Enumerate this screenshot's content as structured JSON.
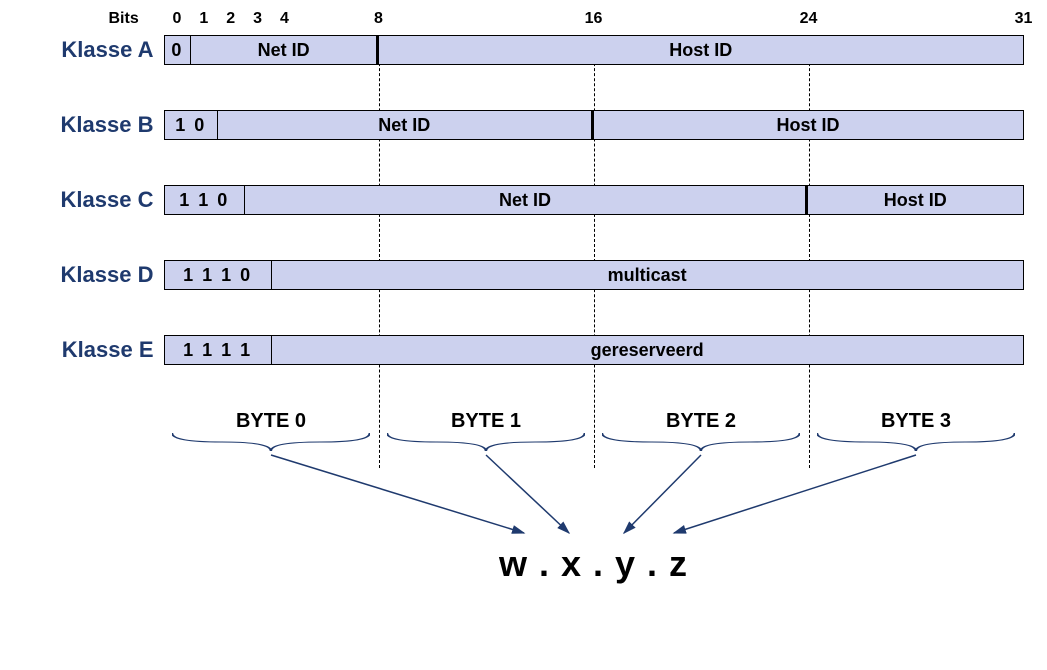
{
  "bits_label": "Bits",
  "bit_positions": [
    0,
    1,
    2,
    3,
    4,
    8,
    16,
    24,
    31
  ],
  "classes": [
    {
      "name": "Klasse A",
      "segments": [
        {
          "label": "0",
          "width_bits": 1,
          "thick": false,
          "cls": "prefix-bits"
        },
        {
          "label": "Net ID",
          "width_bits": 7,
          "thick": true
        },
        {
          "label": "Host ID",
          "width_bits": 24,
          "thick": false
        }
      ]
    },
    {
      "name": "Klasse B",
      "segments": [
        {
          "label": "1 0",
          "width_bits": 2,
          "thick": false,
          "cls": "prefix-bits"
        },
        {
          "label": "Net ID",
          "width_bits": 14,
          "thick": true
        },
        {
          "label": "Host ID",
          "width_bits": 16,
          "thick": false
        }
      ]
    },
    {
      "name": "Klasse C",
      "segments": [
        {
          "label": "1 1 0",
          "width_bits": 3,
          "thick": false,
          "cls": "prefix-bits"
        },
        {
          "label": "Net ID",
          "width_bits": 21,
          "thick": true
        },
        {
          "label": "Host ID",
          "width_bits": 8,
          "thick": false
        }
      ]
    },
    {
      "name": "Klasse D",
      "segments": [
        {
          "label": "1 1 1 0",
          "width_bits": 4,
          "thick": false,
          "cls": "prefix-bits"
        },
        {
          "label": "multicast",
          "width_bits": 28,
          "thick": false
        }
      ]
    },
    {
      "name": "Klasse E",
      "segments": [
        {
          "label": "1 1 1 1",
          "width_bits": 4,
          "thick": false,
          "cls": "prefix-bits"
        },
        {
          "label": "gereserveerd",
          "width_bits": 28,
          "thick": false
        }
      ]
    }
  ],
  "bytes": [
    "BYTE 0",
    "BYTE 1",
    "BYTE 2",
    "BYTE 3"
  ],
  "dotted": "w . x . y . z",
  "colors": {
    "fill": "#ccd1ee",
    "label": "#1f3a6e",
    "arrow": "#1f3a6e"
  }
}
